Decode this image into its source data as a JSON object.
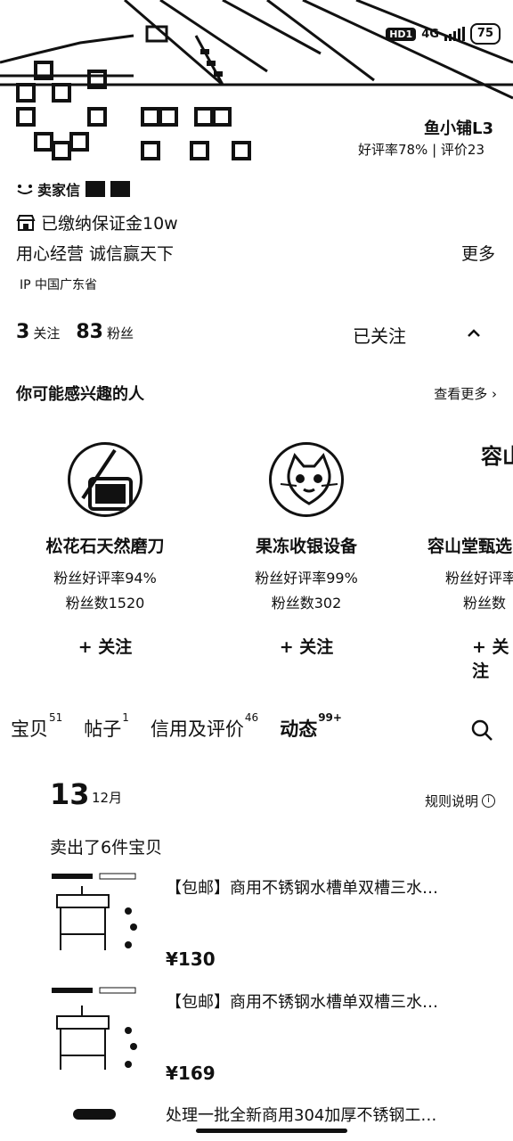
{
  "status_bar": {
    "hd": "HD1",
    "network": "4G",
    "battery": "75"
  },
  "profile": {
    "level_title": "鱼小铺L3",
    "rating": "好评率78% | 评价23",
    "seller_tag": "卖家信",
    "deposit": "已缴纳保证金10w",
    "motto": "用心经营 诚信赢天下",
    "more": "更多",
    "ip": "IP 中国广东省",
    "following_count": "3",
    "following_label": "关注",
    "fans_count": "83",
    "fans_label": "粉丝",
    "followed_button": "已关注"
  },
  "suggestions": {
    "title": "你可能感兴趣的人",
    "more": "查看更多",
    "cards": [
      {
        "name": "松花石天然磨刀",
        "stat1": "粉丝好评率94%",
        "stat2": "粉丝数1520",
        "follow": "+ 关注"
      },
      {
        "name": "果冻收银设备",
        "stat1": "粉丝好评率99%",
        "stat2": "粉丝数302",
        "follow": "+ 关注"
      },
      {
        "name": "容山堂甄选",
        "stat1": "粉丝好评率",
        "stat2": "粉丝数",
        "follow": "+ 关注",
        "avatar_text": "容山堂"
      }
    ]
  },
  "tabs": [
    {
      "label": "宝贝",
      "count": "51"
    },
    {
      "label": "帖子",
      "count": "1"
    },
    {
      "label": "信用及评价",
      "count": "46"
    },
    {
      "label": "动态",
      "count": "99+"
    }
  ],
  "feed": {
    "day": "13",
    "month": "12月",
    "rules": "规则说明",
    "sold_line": "卖出了6件宝贝",
    "items": [
      {
        "title": "【包邮】商用不锈钢水槽单双槽三水…",
        "price": "¥130"
      },
      {
        "title": "【包邮】商用不锈钢水槽单双槽三水…",
        "price": "¥169"
      },
      {
        "title": "处理一批全新商用304加厚不锈钢工…"
      }
    ]
  }
}
